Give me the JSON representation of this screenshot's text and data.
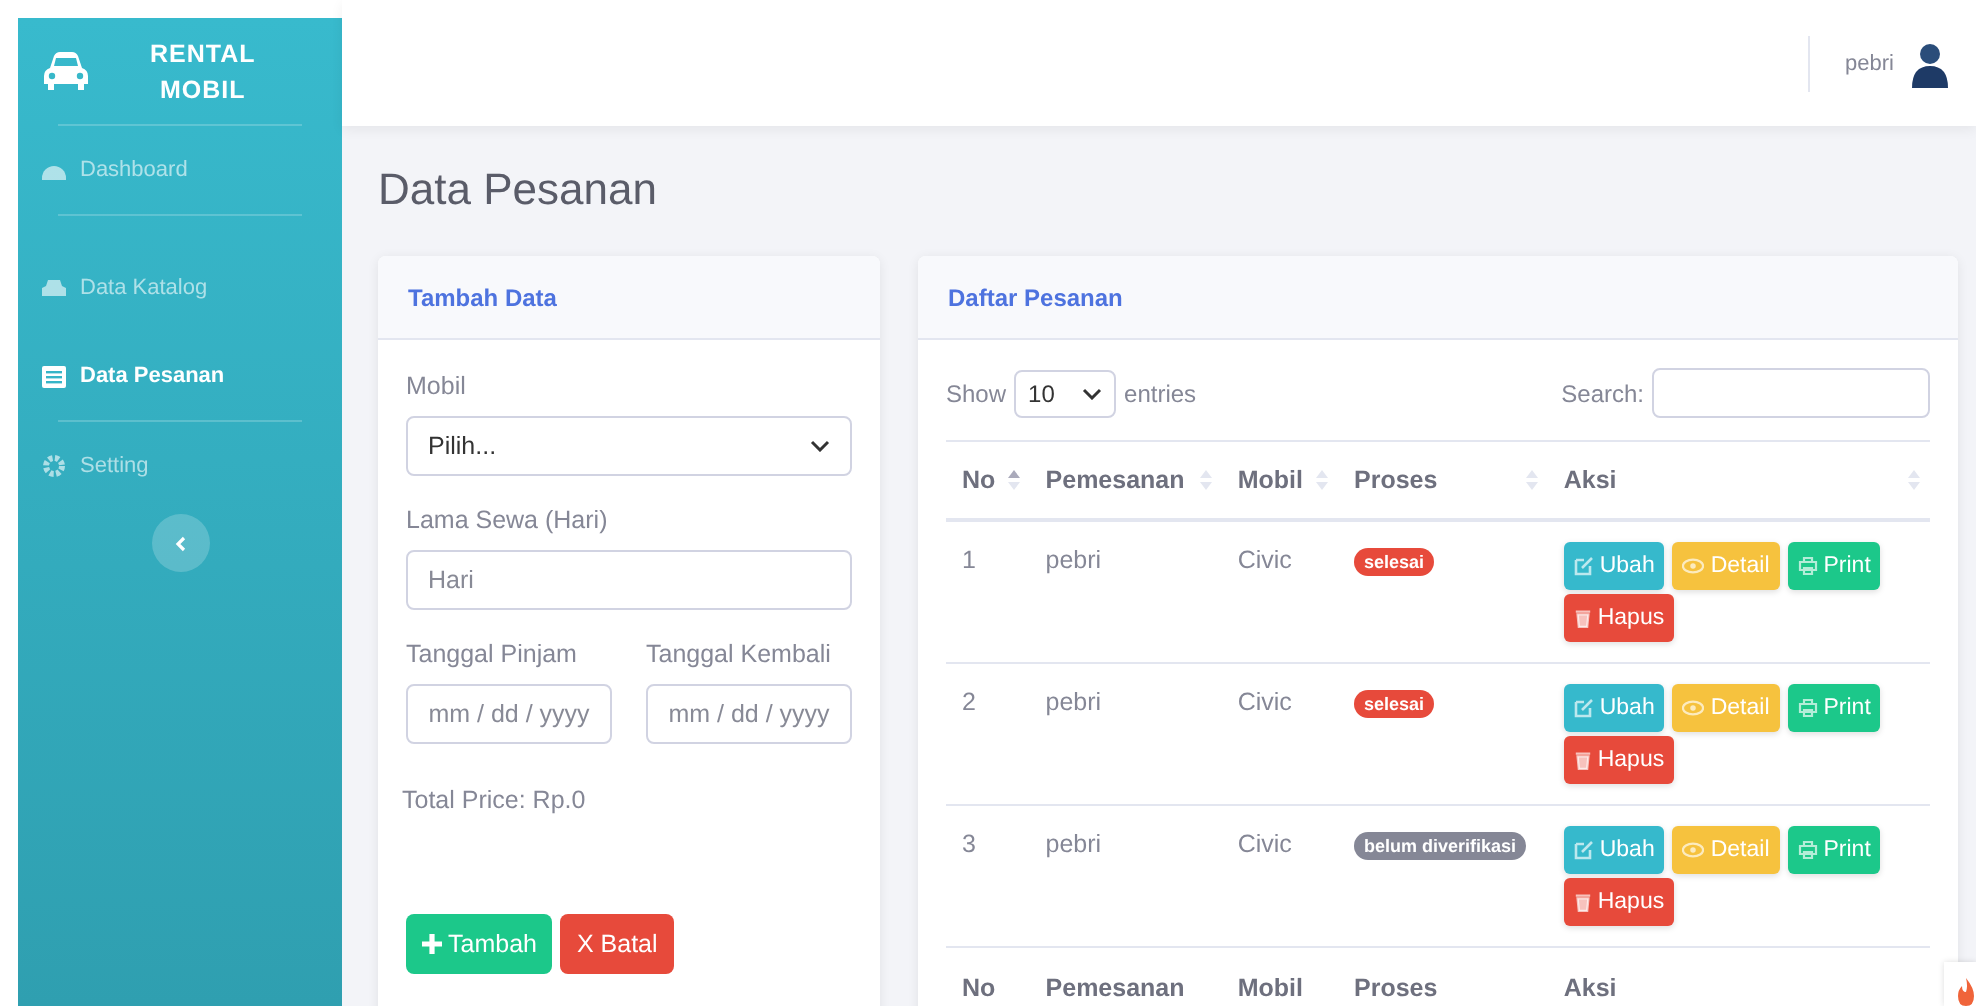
{
  "brand": {
    "line1": "RENTAL",
    "line2": "MOBIL"
  },
  "sidebar": {
    "items": [
      {
        "label": "Dashboard",
        "selected": false
      },
      {
        "label": "Data Katalog",
        "selected": false
      },
      {
        "label": "Data Pesanan",
        "selected": true
      },
      {
        "label": "Setting",
        "selected": false
      }
    ]
  },
  "topbar": {
    "user": "pebri"
  },
  "page_title": "Data Pesanan",
  "form": {
    "title": "Tambah Data",
    "mobil_label": "Mobil",
    "mobil_value": "Pilih...",
    "sewa_label": "Lama Sewa (Hari)",
    "sewa_placeholder": "Hari",
    "pinjam_label": "Tanggal Pinjam",
    "pinjam_placeholder": "mm / dd / yyyy",
    "kembali_label": "Tanggal Kembali",
    "kembali_placeholder": "mm / dd / yyyy",
    "total": "Total Price: Rp.0",
    "buttons": [
      {
        "label": "Tambah",
        "kind": "add"
      },
      {
        "label": "X Batal",
        "kind": "cancel"
      }
    ]
  },
  "table": {
    "title": "Daftar Pesanan",
    "show": "Show",
    "entries_value": "10",
    "entries": "entries",
    "search_label": "Search:",
    "columns": [
      "No",
      "Pemesanan",
      "Mobil",
      "Proses",
      "Aksi"
    ],
    "rows": [
      {
        "no": "1",
        "name": "pebri",
        "car": "Civic",
        "status": "selesai",
        "color": "#e74a3b",
        "actions": [
          {
            "label": "Ubah",
            "kind": "edit"
          },
          {
            "label": "Detail",
            "kind": "detail"
          },
          {
            "label": "Print",
            "kind": "print"
          },
          {
            "label": "Hapus",
            "kind": "delete"
          }
        ]
      },
      {
        "no": "2",
        "name": "pebri",
        "car": "Civic",
        "status": "selesai",
        "color": "#e74a3b",
        "actions": [
          {
            "label": "Ubah",
            "kind": "edit"
          },
          {
            "label": "Detail",
            "kind": "detail"
          },
          {
            "label": "Print",
            "kind": "print"
          },
          {
            "label": "Hapus",
            "kind": "delete"
          }
        ]
      },
      {
        "no": "3",
        "name": "pebri",
        "car": "Civic",
        "status": "belum diverifikasi",
        "color": "#858796",
        "actions": [
          {
            "label": "Ubah",
            "kind": "edit"
          },
          {
            "label": "Detail",
            "kind": "detail"
          },
          {
            "label": "Print",
            "kind": "print"
          },
          {
            "label": "Hapus",
            "kind": "delete"
          }
        ]
      }
    ],
    "footer": [
      "No",
      "Pemesanan",
      "Mobil",
      "Proses",
      "Aksi"
    ]
  }
}
